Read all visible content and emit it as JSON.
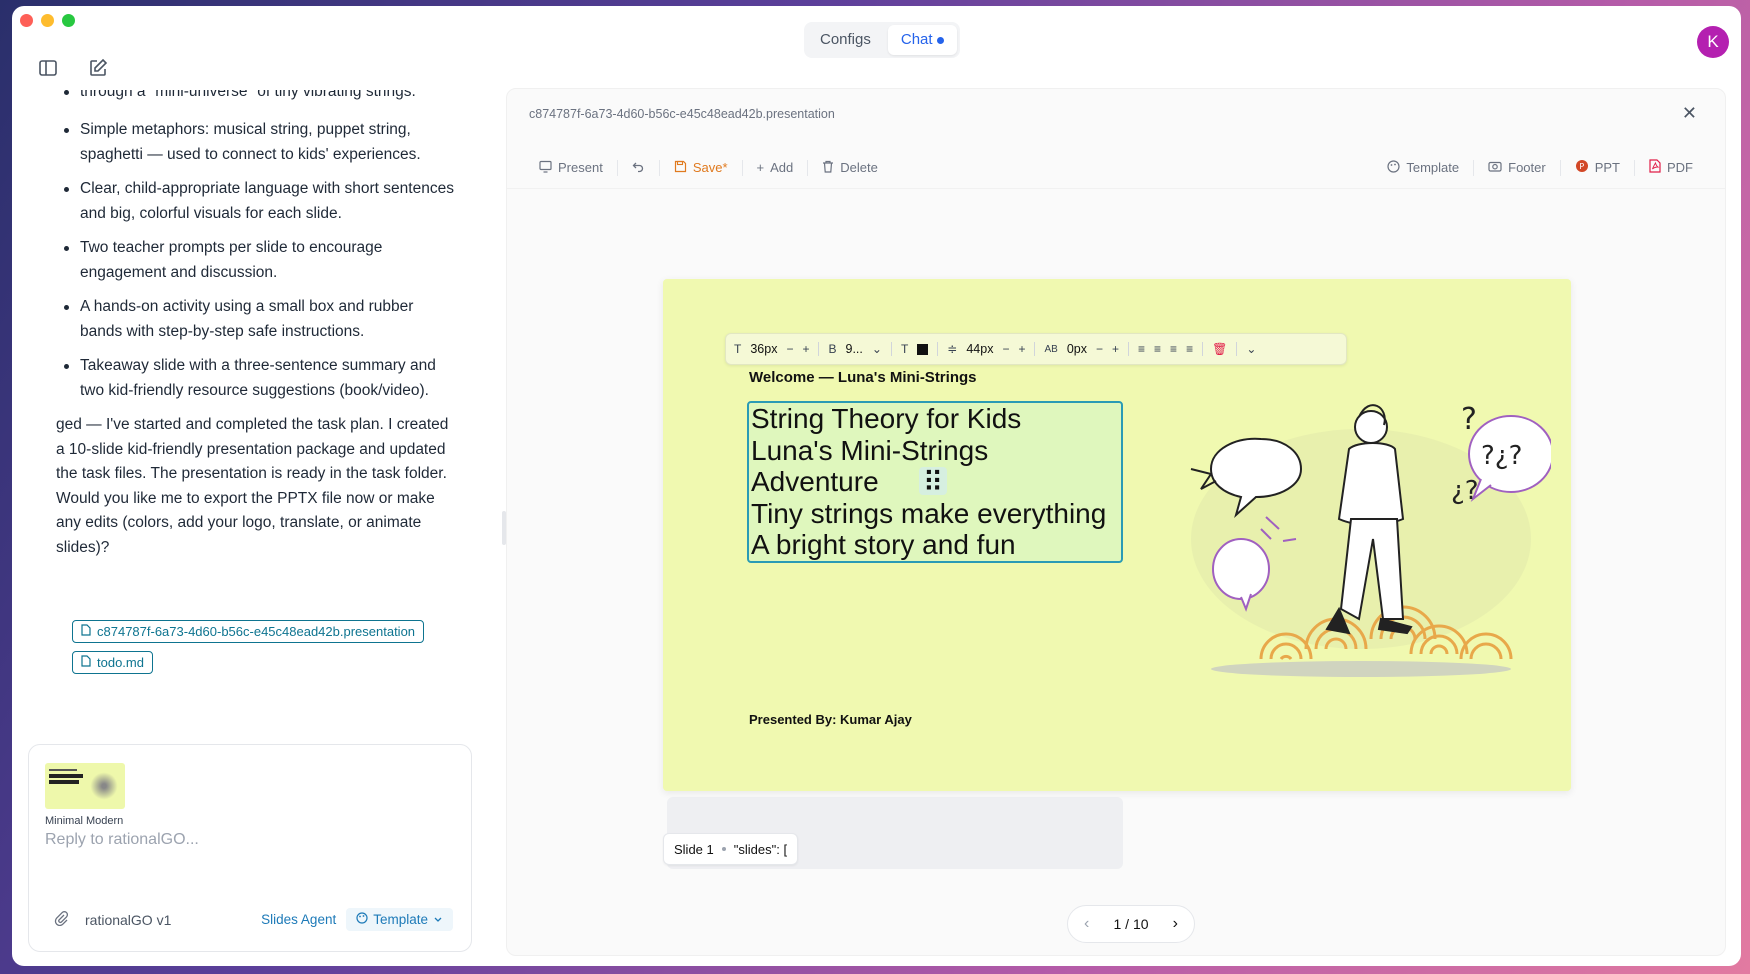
{
  "topnav": {
    "configs": "Configs",
    "chat": "Chat"
  },
  "avatar": "K",
  "chat": {
    "partial_line": "through a \"mini-universe\" of tiny vibrating strings.",
    "bullets": [
      "Simple metaphors: musical string, puppet string, spaghetti — used to connect to kids' experiences.",
      "Clear, child-appropriate language with short sentences and big, colorful visuals for each slide.",
      "Two teacher prompts per slide to encourage engagement and discussion.",
      "A hands-on activity using a small box and rubber bands with step-by-step safe instructions.",
      "Takeaway slide with a three-sentence summary and two kid-friendly resource suggestions (book/video)."
    ],
    "summary": "ged — I've started and completed the task plan. I created a 10-slide kid-friendly presentation package and updated the task files. The presentation is ready in the task folder. Would you like me to export the PPTX file now or make any edits (colors, add your logo, translate, or animate slides)?",
    "files": [
      "c874787f-6a73-4d60-b56c-e45c48ead42b.presentation",
      "todo.md"
    ]
  },
  "composer": {
    "thumb_label": "Minimal Modern",
    "placeholder": "Reply to rationalGO...",
    "model": "rationalGO v1",
    "agent": "Slides Agent",
    "template": "Template"
  },
  "panel": {
    "title": "c874787f-6a73-4d60-b56c-e45c48ead42b.presentation",
    "toolbar": {
      "present": "Present",
      "save": "Save*",
      "add": "Add",
      "delete": "Delete",
      "template": "Template",
      "footer": "Footer",
      "ppt": "PPT",
      "pdf": "PDF"
    },
    "format_bar": {
      "font_size": "36px",
      "font_weight": "9...",
      "line_height": "44px",
      "letter_spacing": "0px"
    },
    "slide": {
      "welcome": "Welcome — Luna's Mini-Strings",
      "title_lines": [
        "String Theory for Kids",
        "Luna's Mini-Strings",
        "Adventure",
        "Tiny strings make everything",
        "A bright story and fun"
      ],
      "presenter": "Presented By: Kumar Ajay"
    },
    "slide_tag": {
      "label": "Slide 1",
      "code": "\"slides\": ["
    },
    "pager": {
      "current": "1 / 10"
    }
  },
  "colors": {
    "accent": "#2563eb",
    "slide_bg": "#f0f9b0",
    "save": "#e07a1f",
    "link": "#1d7ab8"
  }
}
